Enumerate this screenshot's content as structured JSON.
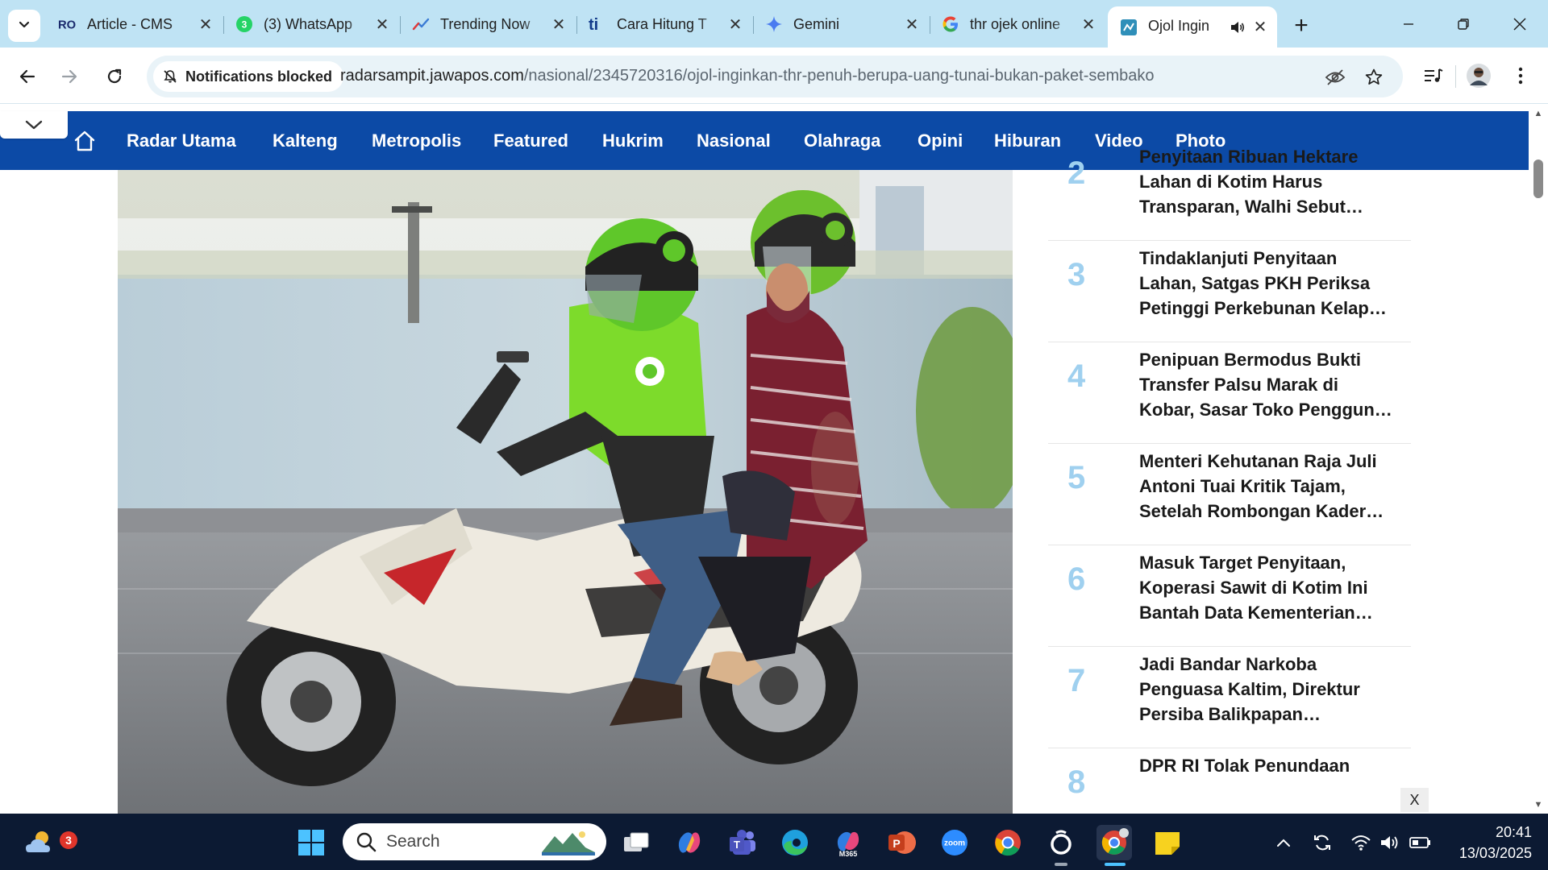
{
  "browser": {
    "tabs": [
      {
        "title": "Article - CMS",
        "icon": "ro-logo-icon"
      },
      {
        "title": "(3) WhatsApp",
        "icon": "whatsapp-icon"
      },
      {
        "title": "Trending Now",
        "icon": "trending-icon"
      },
      {
        "title": "Cara Hitung T",
        "icon": "ti-logo-icon"
      },
      {
        "title": "Gemini",
        "icon": "gemini-icon"
      },
      {
        "title": "thr ojek online",
        "icon": "google-icon"
      },
      {
        "title": "Ojol Ingin",
        "icon": "site-favicon-icon",
        "active": true
      }
    ],
    "notification_chip": "Notifications blocked",
    "url_host": "radarsampit.jawapos.com",
    "url_path": "/nasional/2345720316/ojol-inginkan-thr-penuh-berupa-uang-tunai-bukan-paket-sembako"
  },
  "site": {
    "nav": [
      "Radar Utama",
      "Kalteng",
      "Metropolis",
      "Featured",
      "Hukrim",
      "Nasional",
      "Olahraga",
      "Opini",
      "Hiburan",
      "Video",
      "Photo"
    ],
    "accent": "#0c4aa6",
    "number_color": "#9fd0ef",
    "trending": [
      {
        "num": "2",
        "lines": [
          "Penyitaan Ribuan Hektare",
          "Lahan di Kotim Harus",
          "Transparan, Walhi Sebut…"
        ]
      },
      {
        "num": "3",
        "lines": [
          "Tindaklanjuti Penyitaan",
          "Lahan, Satgas PKH Periksa",
          "Petinggi Perkebunan Kelap…"
        ]
      },
      {
        "num": "4",
        "lines": [
          "Penipuan Bermodus Bukti",
          "Transfer Palsu Marak di",
          "Kobar, Sasar Toko Penggun…"
        ]
      },
      {
        "num": "5",
        "lines": [
          "Menteri Kehutanan Raja Juli",
          "Antoni Tuai Kritik Tajam,",
          "Setelah Rombongan Kader…"
        ]
      },
      {
        "num": "6",
        "lines": [
          "Masuk Target Penyitaan,",
          "Koperasi Sawit di Kotim Ini",
          "Bantah Data Kementerian…"
        ]
      },
      {
        "num": "7",
        "lines": [
          "Jadi Bandar Narkoba",
          "Penguasa Kaltim, Direktur",
          "Persiba Balikpapan…"
        ]
      },
      {
        "num": "8",
        "lines": [
          "DPR RI Tolak Penundaan"
        ]
      }
    ],
    "close_label": "X"
  },
  "taskbar": {
    "search_placeholder": "Search",
    "weather_badge": "3",
    "time": "20:41",
    "date": "13/03/2025",
    "m365_label": "M365",
    "zoom_label": "zoom"
  }
}
